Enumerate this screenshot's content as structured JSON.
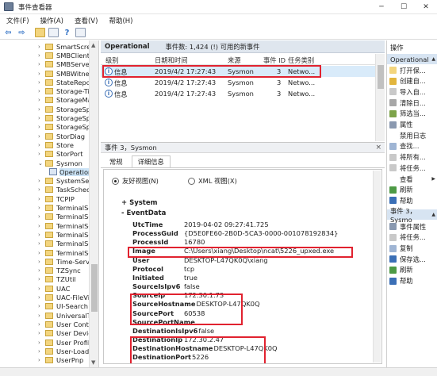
{
  "window": {
    "title": "事件查看器"
  },
  "menu": [
    "文件(F)",
    "操作(A)",
    "查看(V)",
    "帮助(H)"
  ],
  "tree": {
    "items": [
      {
        "label": "SmartScreen"
      },
      {
        "label": "SMBClient"
      },
      {
        "label": "SMBServer"
      },
      {
        "label": "SMBWitnessC"
      },
      {
        "label": "StateReposito"
      },
      {
        "label": "Storage-Tierir"
      },
      {
        "label": "StorageManag"
      },
      {
        "label": "StorageSpace"
      },
      {
        "label": "StorageSpace"
      },
      {
        "label": "StorageSpace"
      },
      {
        "label": "StorDiag"
      },
      {
        "label": "Store"
      },
      {
        "label": "StorPort"
      },
      {
        "label": "Sysmon"
      },
      {
        "label": "Operationa"
      },
      {
        "label": "SystemSetting"
      },
      {
        "label": "TaskSchedule"
      },
      {
        "label": "TCPIP"
      },
      {
        "label": "TerminalServi"
      },
      {
        "label": "TerminalServi"
      },
      {
        "label": "TerminalServi"
      },
      {
        "label": "TerminalServi"
      },
      {
        "label": "TerminalServi"
      },
      {
        "label": "TerminalServi"
      },
      {
        "label": "Time-Service"
      },
      {
        "label": "TZSync"
      },
      {
        "label": "TZUtil"
      },
      {
        "label": "UAC"
      },
      {
        "label": "UAC-FileVirtu"
      },
      {
        "label": "UI-Search"
      },
      {
        "label": "UniversalTele"
      },
      {
        "label": "User Control F"
      },
      {
        "label": "User Device R"
      },
      {
        "label": "User Profile Se"
      },
      {
        "label": "User-Loader"
      },
      {
        "label": "UserPnp"
      }
    ]
  },
  "log_header": {
    "name": "Operational",
    "count": "事件数: 1,424 (!) 可用的新事件"
  },
  "table": {
    "headers": [
      "级别",
      "日期和时间",
      "来源",
      "事件 ID",
      "任务类别"
    ],
    "rows": [
      {
        "level": "信息",
        "datetime": "2019/4/2 17:27:43",
        "source": "Sysmon",
        "id": "3",
        "task": "Netwo..."
      },
      {
        "level": "信息",
        "datetime": "2019/4/2 17:27:43",
        "source": "Sysmon",
        "id": "3",
        "task": "Netwo..."
      },
      {
        "level": "信息",
        "datetime": "2019/4/2 17:27:43",
        "source": "Sysmon",
        "id": "3",
        "task": "Netwo..."
      }
    ]
  },
  "detail_header": {
    "title": "事件 3，Sysmon",
    "close": "×"
  },
  "tabs": [
    "常规",
    "详细信息"
  ],
  "view_options": {
    "friendly": "友好视图(N)",
    "xml": "XML 视图(X)"
  },
  "sections": {
    "system": "+ System",
    "eventdata": "- EventData"
  },
  "event_data": [
    {
      "key": "UtcTime",
      "value": "2019-04-02 09:27:41.725"
    },
    {
      "key": "ProcessGuid",
      "value": "{D5E0FE60-2B0D-5CA3-0000-001078192834}"
    },
    {
      "key": "ProcessId",
      "value": "16780"
    },
    {
      "key": "Image",
      "value": "C:\\Users\\xiang\\Desktop\\ncat\\5226_upxed.exe"
    },
    {
      "key": "User",
      "value": "DESKTOP-L47QK0Q\\xiang"
    },
    {
      "key": "Protocol",
      "value": "tcp"
    },
    {
      "key": "Initiated",
      "value": "true"
    },
    {
      "key": "SourceIsIpv6",
      "value": "false"
    },
    {
      "key": "SourceIp",
      "value": "172.30.1.73"
    },
    {
      "key": "SourceHostname",
      "value": "DESKTOP-L47QK0Q"
    },
    {
      "key": "SourcePort",
      "value": "60538"
    },
    {
      "key": "SourcePortName",
      "value": ""
    },
    {
      "key": "DestinationIsIpv6",
      "value": "false"
    },
    {
      "key": "DestinationIp",
      "value": "172.30.2.47"
    },
    {
      "key": "DestinationHostname",
      "value": "DESKTOP-L47QK0Q"
    },
    {
      "key": "DestinationPort",
      "value": "5226"
    },
    {
      "key": "DestinationPortName",
      "value": ""
    }
  ],
  "actions": {
    "head1": "操作",
    "section1": "Operational",
    "items1": [
      "打开保...",
      "创建自...",
      "导入自...",
      "清除日...",
      "筛选当...",
      "属性",
      "禁用日志",
      "查找...",
      "将所有...",
      "将任务...",
      "查看",
      "刷新",
      "帮助"
    ],
    "section2": "事件 3，Sysmo",
    "items2": [
      "事件属性",
      "将任务...",
      "复制",
      "保存选...",
      "刷新",
      "帮助"
    ]
  }
}
